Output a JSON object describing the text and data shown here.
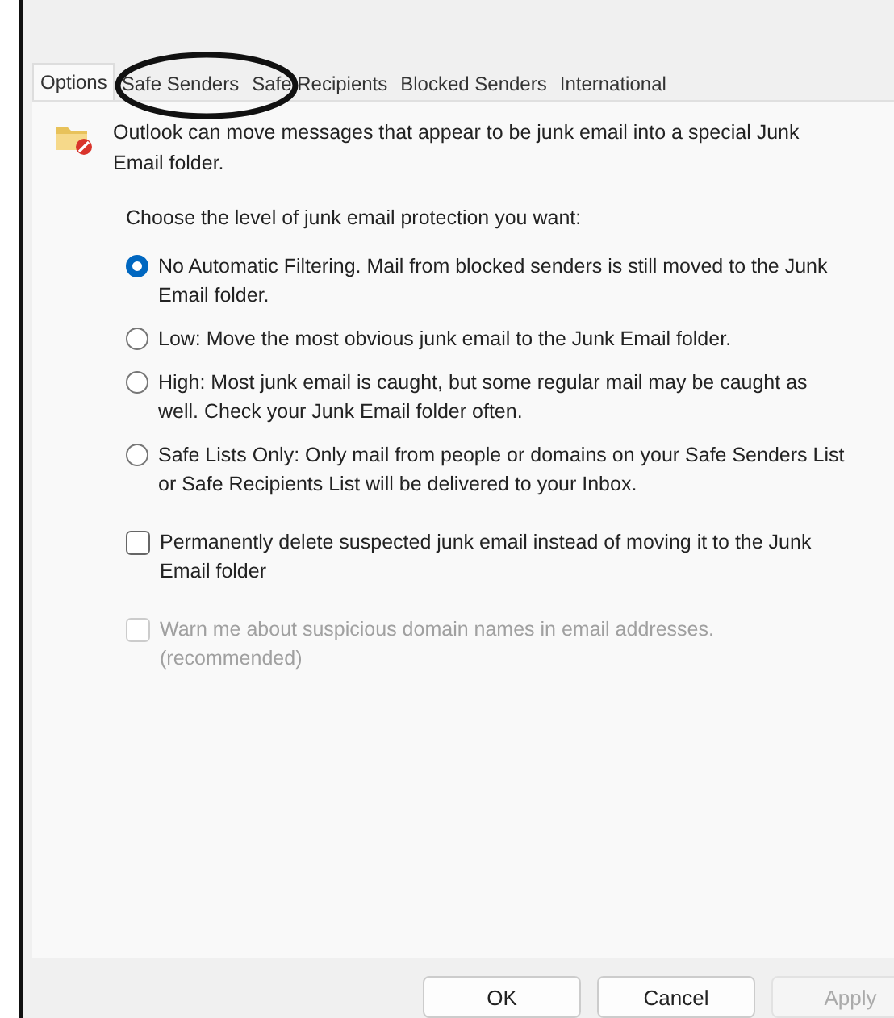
{
  "tabs": [
    {
      "label": "Options",
      "selected": true
    },
    {
      "label": "Safe Senders",
      "selected": false
    },
    {
      "label": "Safe Recipients",
      "selected": false
    },
    {
      "label": "Blocked Senders",
      "selected": false
    },
    {
      "label": "International",
      "selected": false
    }
  ],
  "intro": "Outlook can move messages that appear to be junk email into a special Junk Email folder.",
  "prompt": "Choose the level of junk email protection you want:",
  "options": [
    {
      "kind": "radio",
      "label": "No Automatic Filtering. Mail from blocked senders is still moved to the Junk Email folder.",
      "selected": true
    },
    {
      "kind": "radio",
      "label": "Low: Move the most obvious junk email to the Junk Email folder.",
      "selected": false
    },
    {
      "kind": "radio",
      "label": "High: Most junk email is caught, but some regular mail may be caught as well. Check your Junk Email folder often.",
      "selected": false
    },
    {
      "kind": "radio",
      "label": "Safe Lists Only: Only mail from people or domains on your Safe Senders List or Safe Recipients List will be delivered to your Inbox.",
      "selected": false
    },
    {
      "kind": "checkbox",
      "label": "Permanently delete suspected junk email instead of moving it to the Junk Email folder",
      "checked": false,
      "disabled": false
    },
    {
      "kind": "checkbox",
      "label": "Warn me about suspicious domain names in email addresses. (recommended)",
      "checked": false,
      "disabled": true
    }
  ],
  "buttons": [
    {
      "label": "OK",
      "disabled": false
    },
    {
      "label": "Cancel",
      "disabled": false
    },
    {
      "label": "Apply",
      "disabled": true
    }
  ]
}
